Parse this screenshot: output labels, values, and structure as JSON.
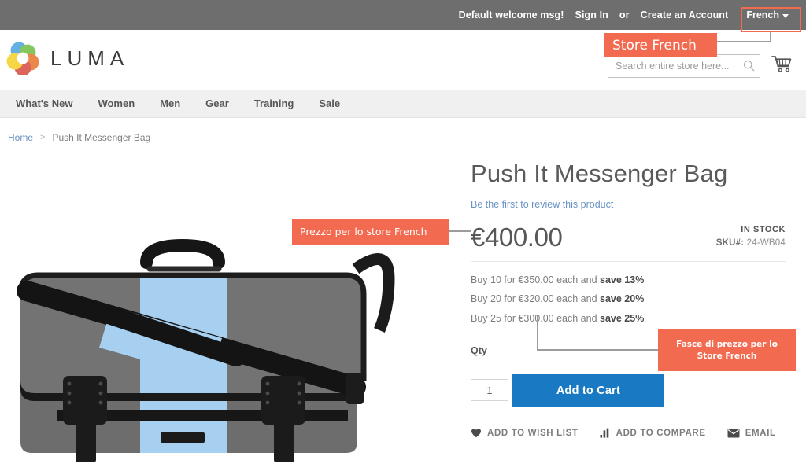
{
  "top_panel": {
    "welcome_msg": "Default welcome msg!",
    "sign_in": "Sign In",
    "or": "or",
    "create_account": "Create an Account",
    "language": "French"
  },
  "header": {
    "logo_text": "LUMA",
    "search_placeholder": "Search entire store here...",
    "cart_icon": "shopping-cart-icon",
    "search_icon": "search-icon"
  },
  "nav": {
    "items": [
      {
        "label": "What's New"
      },
      {
        "label": "Women"
      },
      {
        "label": "Men"
      },
      {
        "label": "Gear"
      },
      {
        "label": "Training"
      },
      {
        "label": "Sale"
      }
    ]
  },
  "breadcrumbs": {
    "home": "Home",
    "separator": ">",
    "current": "Push It Messenger Bag"
  },
  "product": {
    "title": "Push It Messenger Bag",
    "review_link": "Be the first to review this product",
    "price": "€400.00",
    "stock_status": "IN STOCK",
    "sku_label": "SKU#:",
    "sku_value": "24-WB04",
    "tier_prices": [
      {
        "prefix": "Buy 10 for €350.00 each and ",
        "save": "save 13%"
      },
      {
        "prefix": "Buy 20 for €320.00 each and ",
        "save": "save 20%"
      },
      {
        "prefix": "Buy 25 for €300.00 each and ",
        "save": "save 25%"
      }
    ],
    "qty_label": "Qty",
    "qty_value": "1",
    "add_to_cart": "Add to Cart",
    "actions": [
      {
        "label": "ADD TO WISH LIST",
        "icon": "heart-icon"
      },
      {
        "label": "ADD TO COMPARE",
        "icon": "bar-chart-icon"
      },
      {
        "label": "EMAIL",
        "icon": "envelope-icon"
      }
    ],
    "image_alt": "push-it-messenger-bag-image"
  },
  "annotations": {
    "store_french": "Store French",
    "prezzo": "Prezzo per lo store French",
    "fasce_line1": "Fasce di prezzo per lo",
    "fasce_line2": "Store French"
  },
  "colors": {
    "accent": "#f26b51",
    "cta": "#1979c3",
    "top_panel": "#6e6e6e",
    "nav_bg": "#f0f0f0",
    "link": "#6a93c4"
  }
}
